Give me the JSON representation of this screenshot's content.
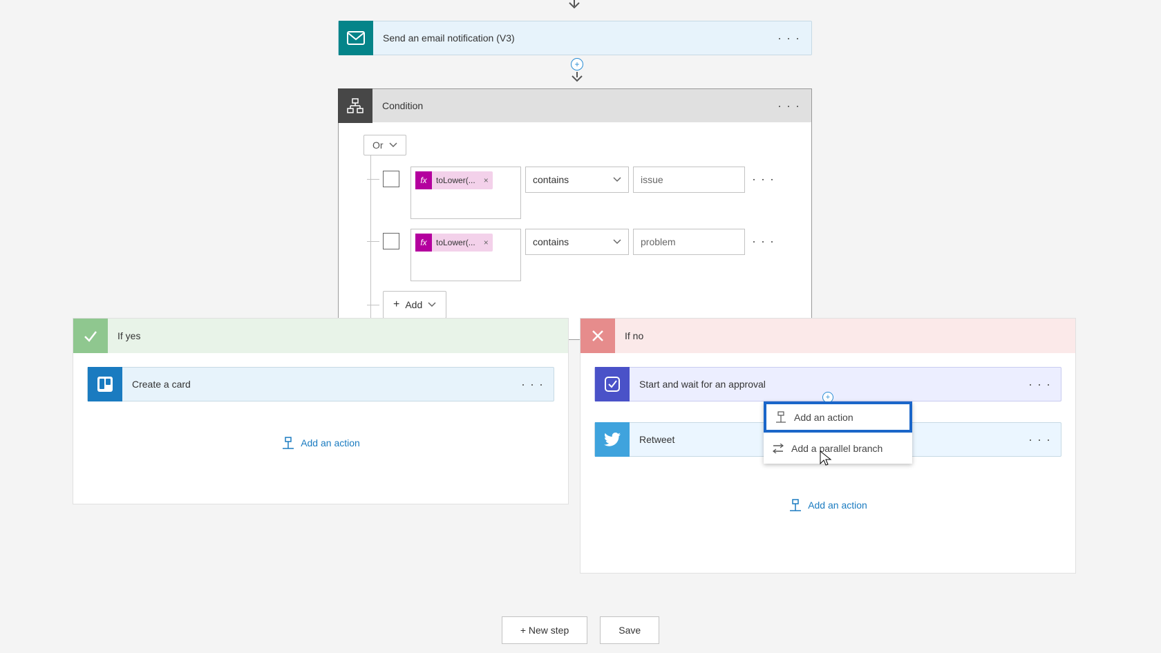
{
  "email_step": {
    "title": "Send an email notification (V3)"
  },
  "condition": {
    "title": "Condition",
    "logic_label": "Or",
    "rows": [
      {
        "expr": "toLower(...",
        "op": "contains",
        "val": "issue"
      },
      {
        "expr": "toLower(...",
        "op": "contains",
        "val": "problem"
      }
    ],
    "add_label": "Add"
  },
  "branches": {
    "yes": {
      "title": "If yes",
      "step1": "Create a card",
      "add_action": "Add an action"
    },
    "no": {
      "title": "If no",
      "step1": "Start and wait for an approval",
      "step2": "Retweet",
      "add_action": "Add an action"
    }
  },
  "popup": {
    "add_action": "Add an action",
    "add_parallel": "Add a parallel branch"
  },
  "footer": {
    "new_step": "+ New step",
    "save": "Save"
  }
}
